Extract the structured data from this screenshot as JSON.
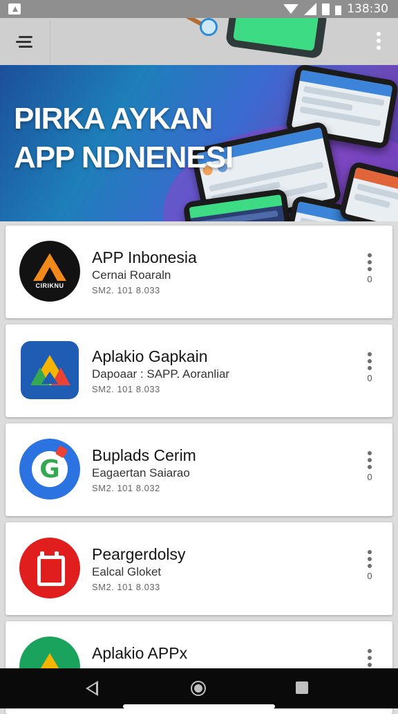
{
  "status_bar": {
    "time": "138:30"
  },
  "hero": {
    "line1": "PIRKA AYKAN",
    "line2": "APP NDNENESI"
  },
  "apps": [
    {
      "title": "APP Inbonesia",
      "subtitle": "Cernai Roaraln",
      "meta": "SM2. 101 8.033",
      "count": "0",
      "icon": "black-triangle-logo",
      "icon_label": "CIRIKNU"
    },
    {
      "title": "Aplakio Gapkain",
      "subtitle": "Dapoaar : SAPP. Aoranliar",
      "meta": "SM2. 101 8.033",
      "count": "0",
      "icon": "drive-logo"
    },
    {
      "title": "Buplads Cerim",
      "subtitle": "Eagaertan Saiarao",
      "meta": "SM2. 101 8.032",
      "count": "0",
      "icon": "g-logo"
    },
    {
      "title": "Peargerdolsy",
      "subtitle": "Ealcal Gloket",
      "meta": "SM2. 101 8.033",
      "count": "0",
      "icon": "calendar-logo"
    },
    {
      "title": "Aplakio APPx",
      "subtitle": "",
      "meta": "",
      "count": "",
      "icon": "green-triangle-logo"
    }
  ],
  "colors": {
    "accent_blue": "#1e5db3",
    "status_gray": "#8f8f8f",
    "hero_purple": "#6b49b8"
  }
}
